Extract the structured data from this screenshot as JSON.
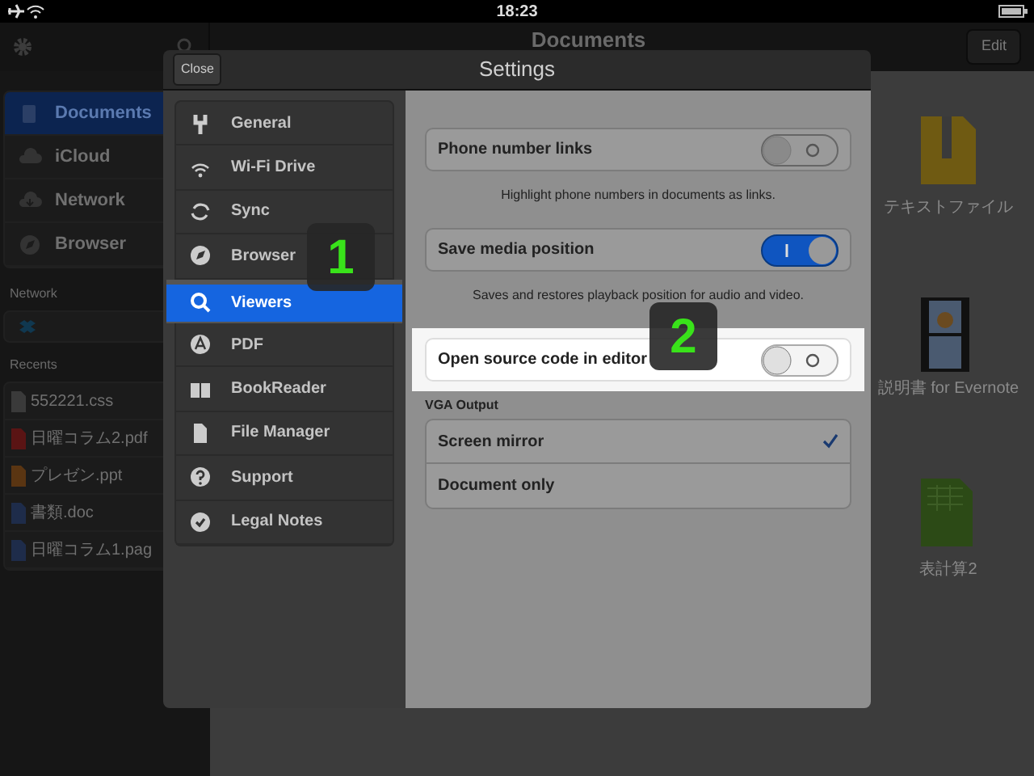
{
  "status_bar": {
    "time": "18:23"
  },
  "toolbar": {
    "title": "Documents",
    "edit_button": "Edit"
  },
  "sidebar": {
    "items": [
      {
        "label": "Documents",
        "selected": true
      },
      {
        "label": "iCloud",
        "selected": false
      },
      {
        "label": "Network",
        "selected": false
      },
      {
        "label": "Browser",
        "selected": false
      }
    ],
    "network_title": "Network",
    "recents_title": "Recents",
    "recents": [
      {
        "name": "552221.css",
        "kind": "css"
      },
      {
        "name": "日曜コラム2.pdf",
        "kind": "pdf"
      },
      {
        "name": "プレゼン.ppt",
        "kind": "ppt"
      },
      {
        "name": "書類.doc",
        "kind": "doc"
      },
      {
        "name": "日曜コラム1.pag",
        "kind": "pages"
      }
    ]
  },
  "files": [
    {
      "name": "テキストファイル",
      "kind": "zip"
    },
    {
      "name": "説明書 for Evernote",
      "kind": "video"
    },
    {
      "name": "表計算2",
      "kind": "xls"
    }
  ],
  "settings": {
    "title": "Settings",
    "close_button": "Close",
    "categories": [
      {
        "label": "General",
        "selected": false
      },
      {
        "label": "Wi-Fi Drive",
        "selected": false
      },
      {
        "label": "Sync",
        "selected": false
      },
      {
        "label": "Browser",
        "selected": false
      },
      {
        "label": "Viewers",
        "selected": true
      },
      {
        "label": "PDF",
        "selected": false
      },
      {
        "label": "BookReader",
        "selected": false
      },
      {
        "label": "File Manager",
        "selected": false
      },
      {
        "label": "Support",
        "selected": false
      },
      {
        "label": "Legal Notes",
        "selected": false
      }
    ],
    "rows": [
      {
        "label": "Phone number links",
        "on": false,
        "highlighted": false,
        "footer": "Highlight phone numbers in documents as links."
      },
      {
        "label": "Save media position",
        "on": true,
        "highlighted": false,
        "footer": "Saves and restores playback position for audio and video."
      },
      {
        "label": "Open source code in editor",
        "on": false,
        "highlighted": true
      }
    ],
    "vga_title": "VGA Output",
    "vga_options": [
      {
        "label": "Screen mirror",
        "selected": true
      },
      {
        "label": "Document only",
        "selected": false
      }
    ]
  },
  "callouts": [
    {
      "number": "1"
    },
    {
      "number": "2"
    }
  ]
}
